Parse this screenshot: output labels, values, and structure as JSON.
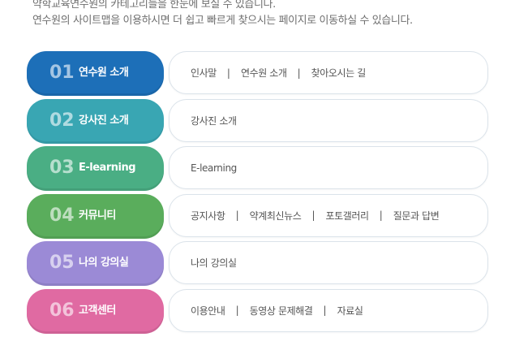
{
  "intro": {
    "line1": "약학교육연수원의 카테고리들을 한눈에 보실 수 있습니다.",
    "line2": "연수원의 사이트맵을 이용하시면 더 쉽고 빠르게 찾으시는 페이지로 이동하실 수 있습니다."
  },
  "categories": [
    {
      "num": "01",
      "label": "연수원 소개",
      "color": "#1d6fb8",
      "links": [
        "인사말",
        "연수원 소개",
        "찾아오시는 길"
      ]
    },
    {
      "num": "02",
      "label": "강사진 소개",
      "color": "#39a6b3",
      "links": [
        "강사진 소개"
      ]
    },
    {
      "num": "03",
      "label": "E-learning",
      "color": "#4aae84",
      "links": [
        "E-learning"
      ]
    },
    {
      "num": "04",
      "label": "커뮤니티",
      "color": "#5aad5c",
      "links": [
        "공지사항",
        "약계최신뉴스",
        "포토갤러리",
        "질문과 답변"
      ]
    },
    {
      "num": "05",
      "label": "나의 강의실",
      "color": "#9b8ad6",
      "links": [
        "나의 강의실"
      ]
    },
    {
      "num": "06",
      "label": "고객센터",
      "color": "#e06aa2",
      "links": [
        "이용안내",
        "동영상 문제해결",
        "자료실"
      ]
    }
  ],
  "separator": "|"
}
